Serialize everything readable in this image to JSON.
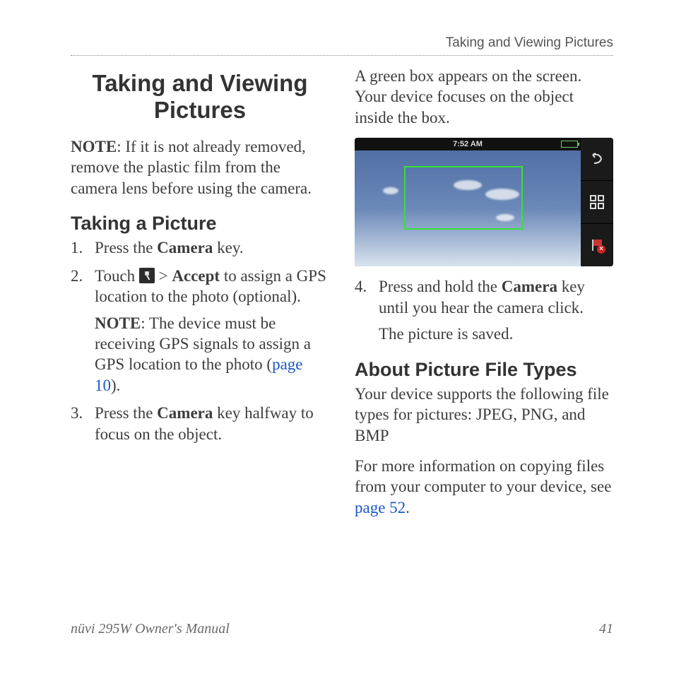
{
  "running_head": "Taking and Viewing Pictures",
  "title": "Taking and Viewing Pictures",
  "note_label": "NOTE",
  "intro_note": ": If it is not already removed, remove the plastic film from the camera lens before using the camera.",
  "section_taking": "Taking a Picture",
  "steps": {
    "s1_a": "Press the ",
    "s1_bold": "Camera",
    "s1_b": " key.",
    "s2_a": "Touch ",
    "s2_sep": " > ",
    "s2_bold": "Accept",
    "s2_b": " to assign a GPS location to the photo (optional).",
    "s2_note_label": "NOTE",
    "s2_note_a": ": The device must be receiving GPS signals to assign a GPS location to the photo (",
    "s2_link": "page 10",
    "s2_note_b": ").",
    "s3_a": "Press the ",
    "s3_bold": "Camera",
    "s3_b": " key halfway to focus on the object.",
    "s4_a": "Press and hold the ",
    "s4_bold": "Camera",
    "s4_b": " key until you hear the camera click.",
    "s4_after": "The picture is saved."
  },
  "col2_intro": "A green box appears on the screen. Your device focuses on the object inside the box.",
  "shot": {
    "time": "7:52 AM"
  },
  "section_about": "About Picture File Types",
  "about_p1": "Your device supports the following file types for pictures: JPEG, PNG, and BMP",
  "about_p2a": "For more information on copying files from your computer to your device, see ",
  "about_link": "page 52",
  "about_p2b": ".",
  "footer_left": "nüvi 295W Owner's Manual",
  "footer_right": "41",
  "nums": {
    "n1": "1.",
    "n2": "2.",
    "n3": "3.",
    "n4": "4."
  }
}
